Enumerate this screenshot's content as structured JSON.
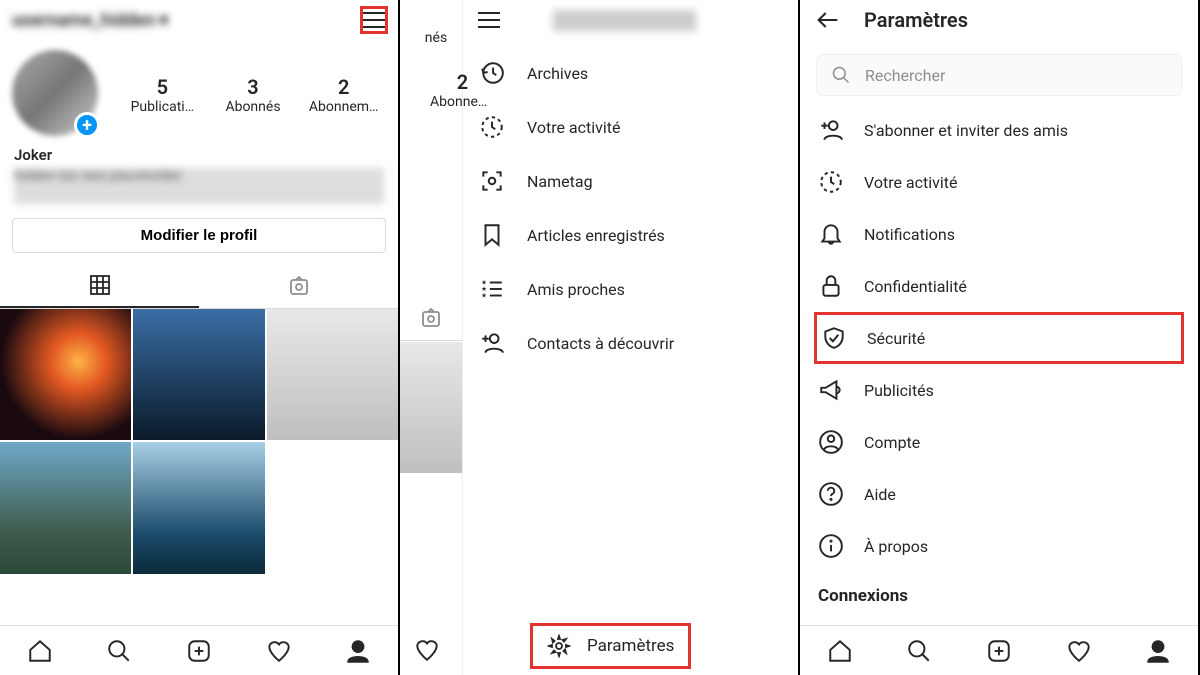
{
  "panel1": {
    "username": "username_hidden",
    "stats": [
      {
        "count": "5",
        "label": "Publicati…"
      },
      {
        "count": "3",
        "label": "Abonnés"
      },
      {
        "count": "2",
        "label": "Abonnem…"
      }
    ],
    "bio_name": "Joker",
    "bio_text": "hidden bio text placeholder",
    "edit_button": "Modifier le profil"
  },
  "panel2": {
    "username": "username_hidden",
    "partial_stats": [
      {
        "count": "",
        "label": "nés"
      },
      {
        "count": "2",
        "label": "Abonnem…"
      }
    ],
    "menu": [
      {
        "key": "archives",
        "label": "Archives",
        "icon": "clock-back"
      },
      {
        "key": "activity",
        "label": "Votre activité",
        "icon": "activity-clock"
      },
      {
        "key": "nametag",
        "label": "Nametag",
        "icon": "scan"
      },
      {
        "key": "saved",
        "label": "Articles enregistrés",
        "icon": "bookmark"
      },
      {
        "key": "close_friends",
        "label": "Amis proches",
        "icon": "star-list"
      },
      {
        "key": "discover",
        "label": "Contacts à découvrir",
        "icon": "person-plus"
      }
    ],
    "settings_label": "Paramètres"
  },
  "panel3": {
    "title": "Paramètres",
    "search_placeholder": "Rechercher",
    "items": [
      {
        "key": "follow_invite",
        "label": "S'abonner et inviter des amis",
        "icon": "person-plus"
      },
      {
        "key": "activity",
        "label": "Votre activité",
        "icon": "activity-clock"
      },
      {
        "key": "notifications",
        "label": "Notifications",
        "icon": "bell"
      },
      {
        "key": "privacy",
        "label": "Confidentialité",
        "icon": "lock"
      },
      {
        "key": "security",
        "label": "Sécurité",
        "icon": "shield-check",
        "highlight": true
      },
      {
        "key": "ads",
        "label": "Publicités",
        "icon": "megaphone"
      },
      {
        "key": "account",
        "label": "Compte",
        "icon": "person-circle"
      },
      {
        "key": "help",
        "label": "Aide",
        "icon": "help-circle"
      },
      {
        "key": "about",
        "label": "À propos",
        "icon": "info-circle"
      }
    ],
    "section_title": "Connexions"
  }
}
